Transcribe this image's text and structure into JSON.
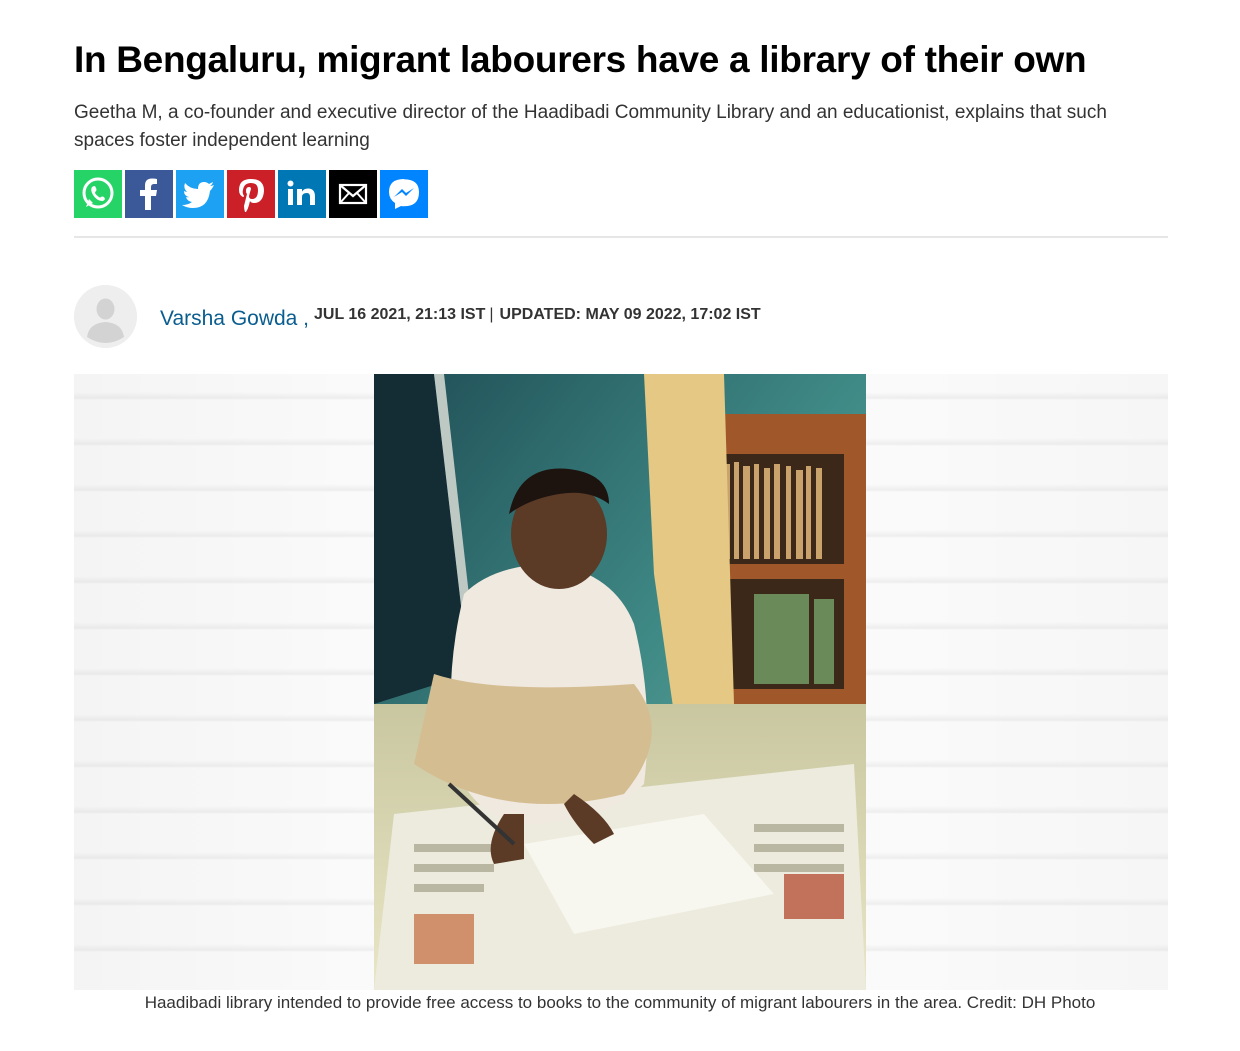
{
  "article": {
    "headline": "In Bengaluru, migrant labourers have a library of their own",
    "subhead": "Geetha M, a co-founder and executive director of the Haadibadi Community Library and an educationist, explains that such spaces foster independent learning"
  },
  "share": {
    "buttons": [
      {
        "name": "whatsapp",
        "icon": "whatsapp-icon",
        "color": "#25d366"
      },
      {
        "name": "facebook",
        "icon": "facebook-icon",
        "color": "#3b5998"
      },
      {
        "name": "twitter",
        "icon": "twitter-icon",
        "color": "#1da1f2"
      },
      {
        "name": "pinterest",
        "icon": "pinterest-icon",
        "color": "#cb2027"
      },
      {
        "name": "linkedin",
        "icon": "linkedin-icon",
        "color": "#0077b5"
      },
      {
        "name": "email",
        "icon": "email-icon",
        "color": "#000000"
      },
      {
        "name": "messenger",
        "icon": "messenger-icon",
        "color": "#0084ff"
      }
    ]
  },
  "byline": {
    "author": "Varsha Gowda ,",
    "published": "JUL 16 2021, 21:13 IST",
    "separator": "|",
    "updated": "UPDATED: MAY 09 2022, 17:02 IST"
  },
  "image": {
    "caption": "Haadibadi library intended to provide free access to books to the community of migrant labourers in the area. Credit: DH Photo"
  }
}
